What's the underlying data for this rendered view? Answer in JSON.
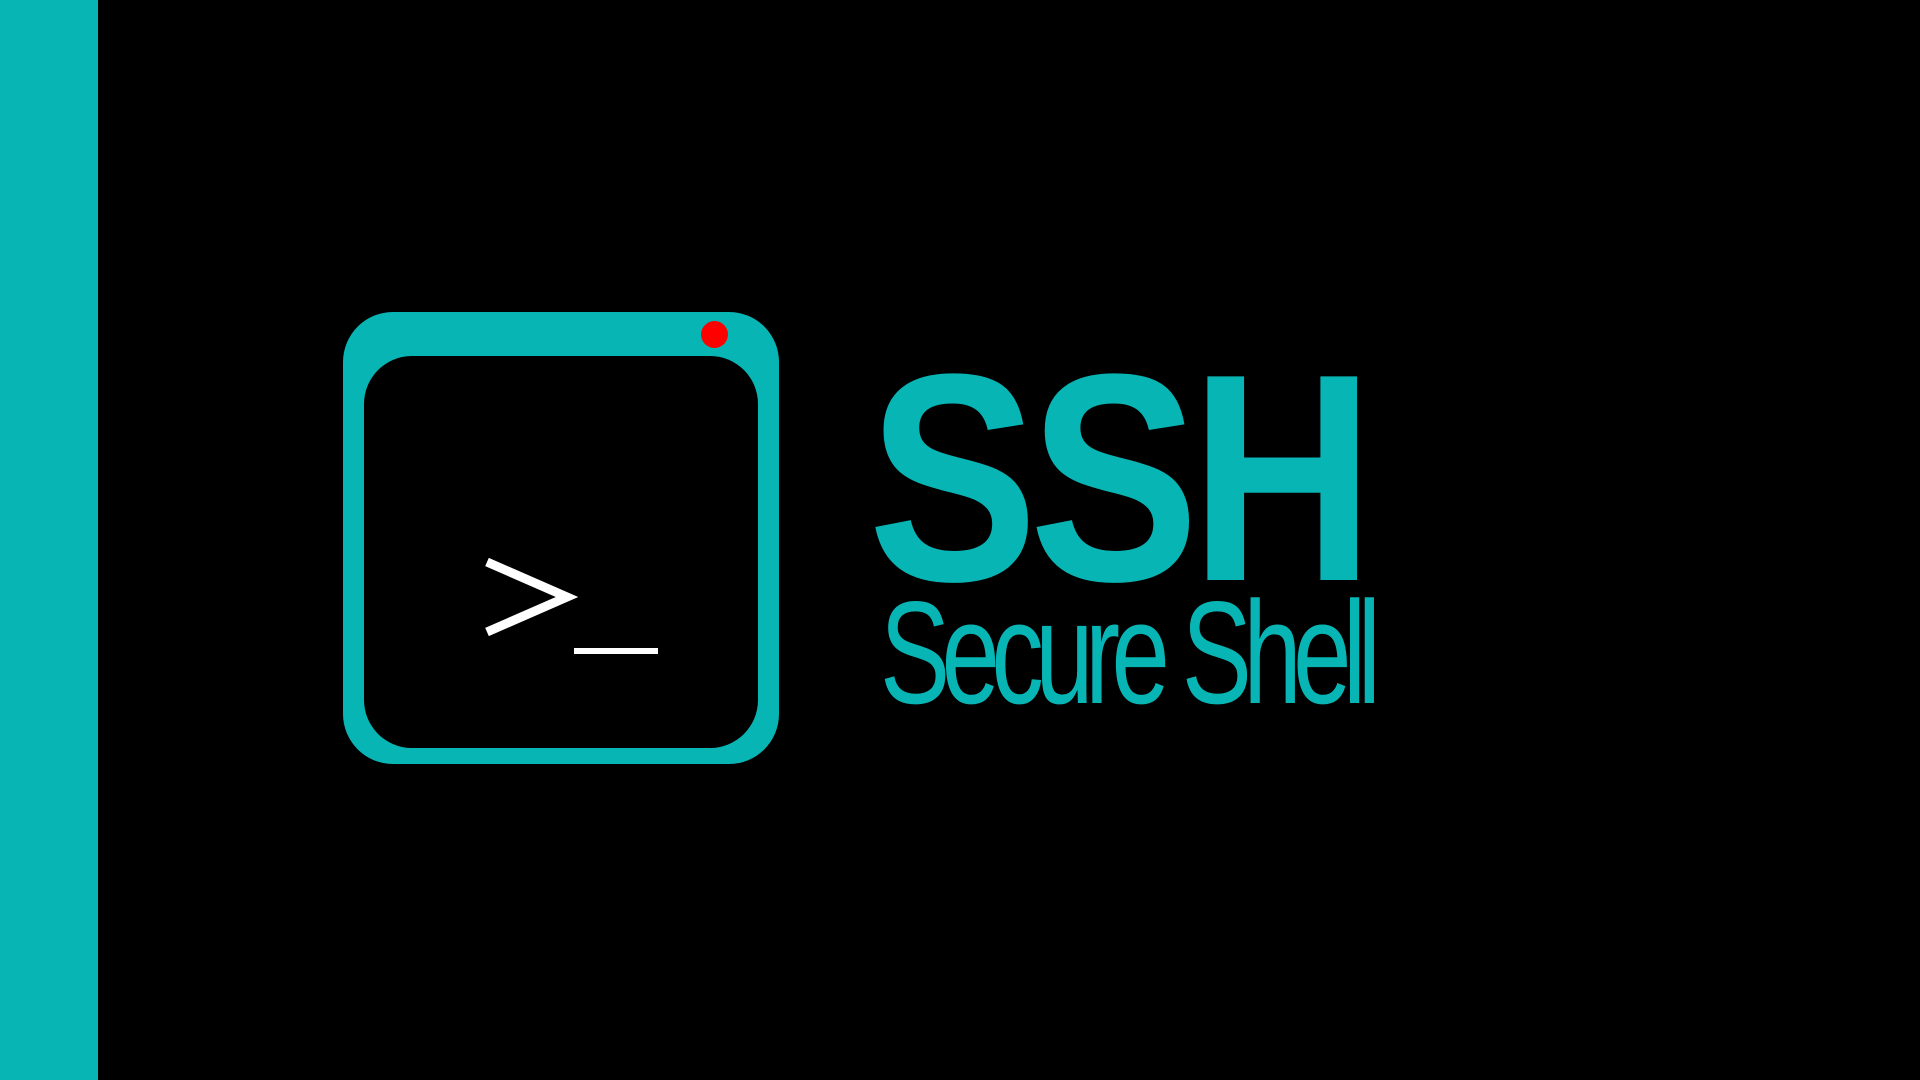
{
  "logo": {
    "title": "SSH",
    "subtitle": "Secure Shell",
    "icon": "terminal-window-icon",
    "prompt_symbol": ">_"
  },
  "colors": {
    "accent": "#08b5b5",
    "background": "#000000",
    "dot": "#ff0000",
    "prompt": "#ffffff"
  }
}
